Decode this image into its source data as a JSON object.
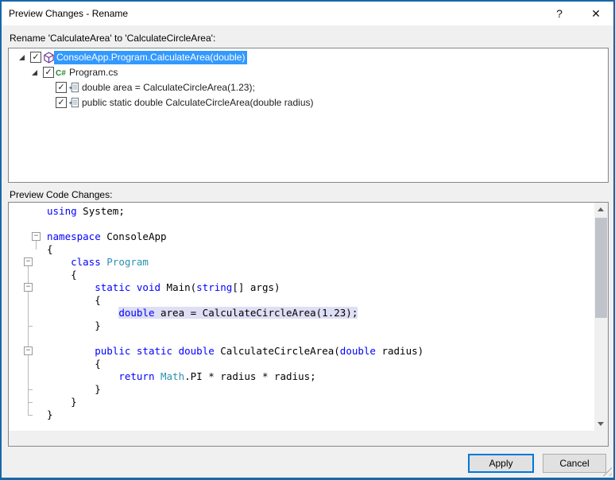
{
  "dialog": {
    "title": "Preview Changes - Rename",
    "help_icon": "?",
    "close_icon": "✕"
  },
  "rename_label": "Rename 'CalculateArea' to 'CalculateCircleArea':",
  "preview_label": "Preview Code Changes:",
  "tree": {
    "items": [
      {
        "label": "ConsoleApp.Program.CalculateArea(double)",
        "level": 0,
        "icon": "method",
        "expanded": true,
        "checked": true,
        "selected": true
      },
      {
        "label": "Program.cs",
        "level": 1,
        "icon": "csharp",
        "expanded": true,
        "checked": true,
        "selected": false
      },
      {
        "label": "double area = CalculateCircleArea(1.23);",
        "level": 2,
        "icon": "change",
        "checked": true,
        "selected": false
      },
      {
        "label": "public static double CalculateCircleArea(double radius)",
        "level": 2,
        "icon": "change",
        "checked": true,
        "selected": false
      }
    ],
    "checkmark": "✓"
  },
  "code": {
    "fold_boxes": [
      3,
      5,
      7,
      12
    ],
    "fold_glyph": "−",
    "lines": [
      {
        "tok": [
          [
            "kw",
            "using"
          ],
          [
            "pl",
            " System;"
          ]
        ]
      },
      {
        "tok": []
      },
      {
        "tok": [
          [
            "kw",
            "namespace"
          ],
          [
            "pl",
            " ConsoleApp"
          ]
        ]
      },
      {
        "tok": [
          [
            "pl",
            "{"
          ]
        ]
      },
      {
        "tok": [
          [
            "pl",
            "    "
          ],
          [
            "kw",
            "class"
          ],
          [
            "pl",
            " "
          ],
          [
            "ty",
            "Program"
          ]
        ]
      },
      {
        "tok": [
          [
            "pl",
            "    {"
          ]
        ]
      },
      {
        "tok": [
          [
            "pl",
            "        "
          ],
          [
            "kw",
            "static"
          ],
          [
            "pl",
            " "
          ],
          [
            "kw",
            "void"
          ],
          [
            "pl",
            " Main("
          ],
          [
            "kw",
            "string"
          ],
          [
            "pl",
            "[] args)"
          ]
        ]
      },
      {
        "tok": [
          [
            "pl",
            "        {"
          ]
        ]
      },
      {
        "ind": "            ",
        "hl": true,
        "tok": [
          [
            "kw",
            "double"
          ],
          [
            "pl",
            " area = CalculateCircleArea(1.23);"
          ]
        ]
      },
      {
        "tok": [
          [
            "pl",
            "        }"
          ]
        ]
      },
      {
        "tok": []
      },
      {
        "tok": [
          [
            "pl",
            "        "
          ],
          [
            "kw",
            "public"
          ],
          [
            "pl",
            " "
          ],
          [
            "kw",
            "static"
          ],
          [
            "pl",
            " "
          ],
          [
            "kw",
            "double"
          ],
          [
            "pl",
            " CalculateCircleArea("
          ],
          [
            "kw",
            "double"
          ],
          [
            "pl",
            " radius)"
          ]
        ]
      },
      {
        "tok": [
          [
            "pl",
            "        {"
          ]
        ]
      },
      {
        "tok": [
          [
            "pl",
            "            "
          ],
          [
            "kw",
            "return"
          ],
          [
            "pl",
            " "
          ],
          [
            "ty",
            "Math"
          ],
          [
            "pl",
            ".PI * radius * radius;"
          ]
        ]
      },
      {
        "tok": [
          [
            "pl",
            "        }"
          ]
        ]
      },
      {
        "tok": [
          [
            "pl",
            "    }"
          ]
        ]
      },
      {
        "tok": [
          [
            "pl",
            "}"
          ]
        ]
      }
    ]
  },
  "buttons": {
    "apply": "Apply",
    "cancel": "Cancel"
  },
  "colors": {
    "frame": "#1768A8",
    "accent": "#0078D7",
    "selection": "#3399FF",
    "keyword": "#0000FF",
    "type": "#2B91AF",
    "highlight": "#DEDEF4",
    "csharp_green": "#27862C",
    "method_purple": "#652D90",
    "titlebar_bg": "#FFFFFF",
    "dialog_bg": "#F0F0F0"
  }
}
